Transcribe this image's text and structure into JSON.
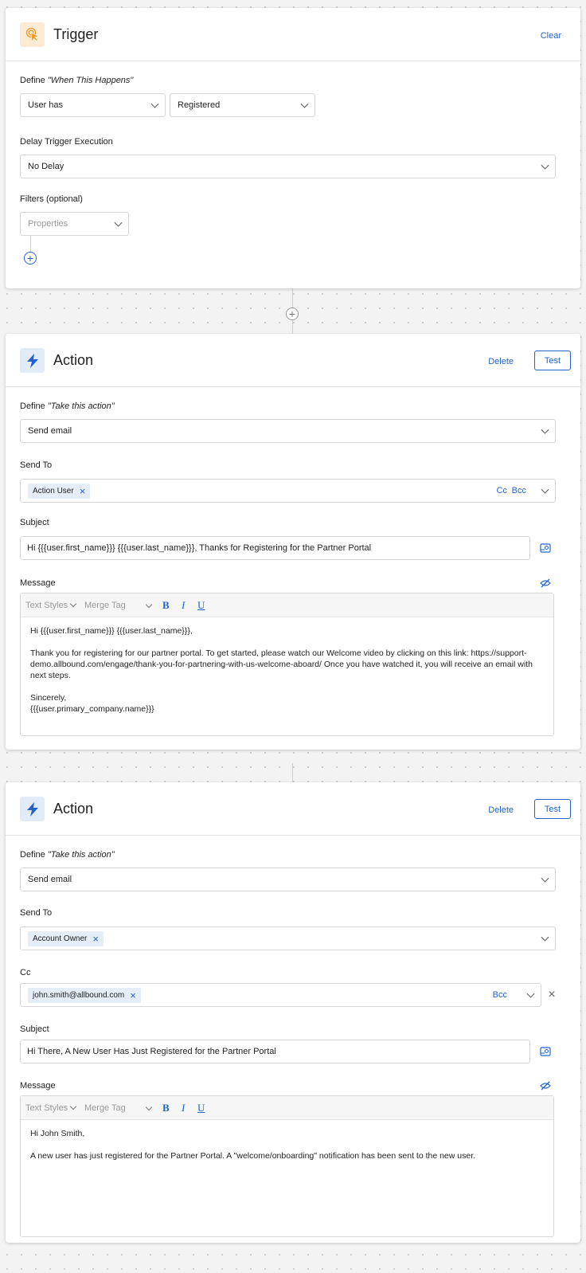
{
  "trigger": {
    "title": "Trigger",
    "clear_label": "Clear",
    "define_label": "Define",
    "define_italic": "\"When This Happens\"",
    "user_has": "User has",
    "event": "Registered",
    "delay_label": "Delay Trigger Execution",
    "delay_value": "No Delay",
    "filters_label": "Filters (optional)",
    "properties_placeholder": "Properties",
    "add_symbol": "+"
  },
  "connector": {
    "add_symbol": "+"
  },
  "action1": {
    "title": "Action",
    "delete_label": "Delete",
    "test_label": "Test",
    "define_label": "Define",
    "define_italic": "\"Take this action\"",
    "action_value": "Send email",
    "send_to_label": "Send To",
    "recipient_tag": "Action User",
    "cc_label": "Cc",
    "bcc_label": "Bcc",
    "subject_label": "Subject",
    "subject_value": "Hi {{{user.first_name}}} {{{user.last_name}}}, Thanks for Registering for the Partner Portal",
    "message_label": "Message",
    "toolbar": {
      "text_styles": "Text Styles",
      "merge_tag": "Merge Tag",
      "bold": "B",
      "italic": "I",
      "underline": "U"
    },
    "body": {
      "greeting": "Hi {{{user.first_name}}} {{{user.last_name}}},",
      "paragraph": "Thank you for registering for our partner portal. To get started, please watch our Welcome video by clicking on this link: https://support-demo.allbound.com/engage/thank-you-for-partnering-with-us-welcome-aboard/ Once you have watched it, you will receive an email with next steps.",
      "signoff": "Sincerely,",
      "signature": "{{{user.primary_company.name}}}"
    }
  },
  "action2": {
    "title": "Action",
    "delete_label": "Delete",
    "test_label": "Test",
    "define_label": "Define",
    "define_italic": "\"Take this action\"",
    "action_value": "Send email",
    "send_to_label": "Send To",
    "recipient_tag": "Account Owner",
    "cc_field_label": "Cc",
    "cc_tag": "john.smith@allbound.com",
    "bcc_label": "Bcc",
    "subject_label": "Subject",
    "subject_value": "Hi There, A New User Has Just Registered for the Partner Portal",
    "message_label": "Message",
    "toolbar": {
      "text_styles": "Text Styles",
      "merge_tag": "Merge Tag",
      "bold": "B",
      "italic": "I",
      "underline": "U"
    },
    "body": {
      "greeting": "Hi John Smith,",
      "paragraph": "A new user has just registered for the Partner Portal. A \"welcome/onboarding\" notification has been sent to the new user."
    }
  },
  "colors": {
    "accent": "#2563c9",
    "trigger_icon_bg": "#fdebd3",
    "action_icon_bg": "#e2ecf9",
    "trigger_icon": "#f29a2e"
  }
}
